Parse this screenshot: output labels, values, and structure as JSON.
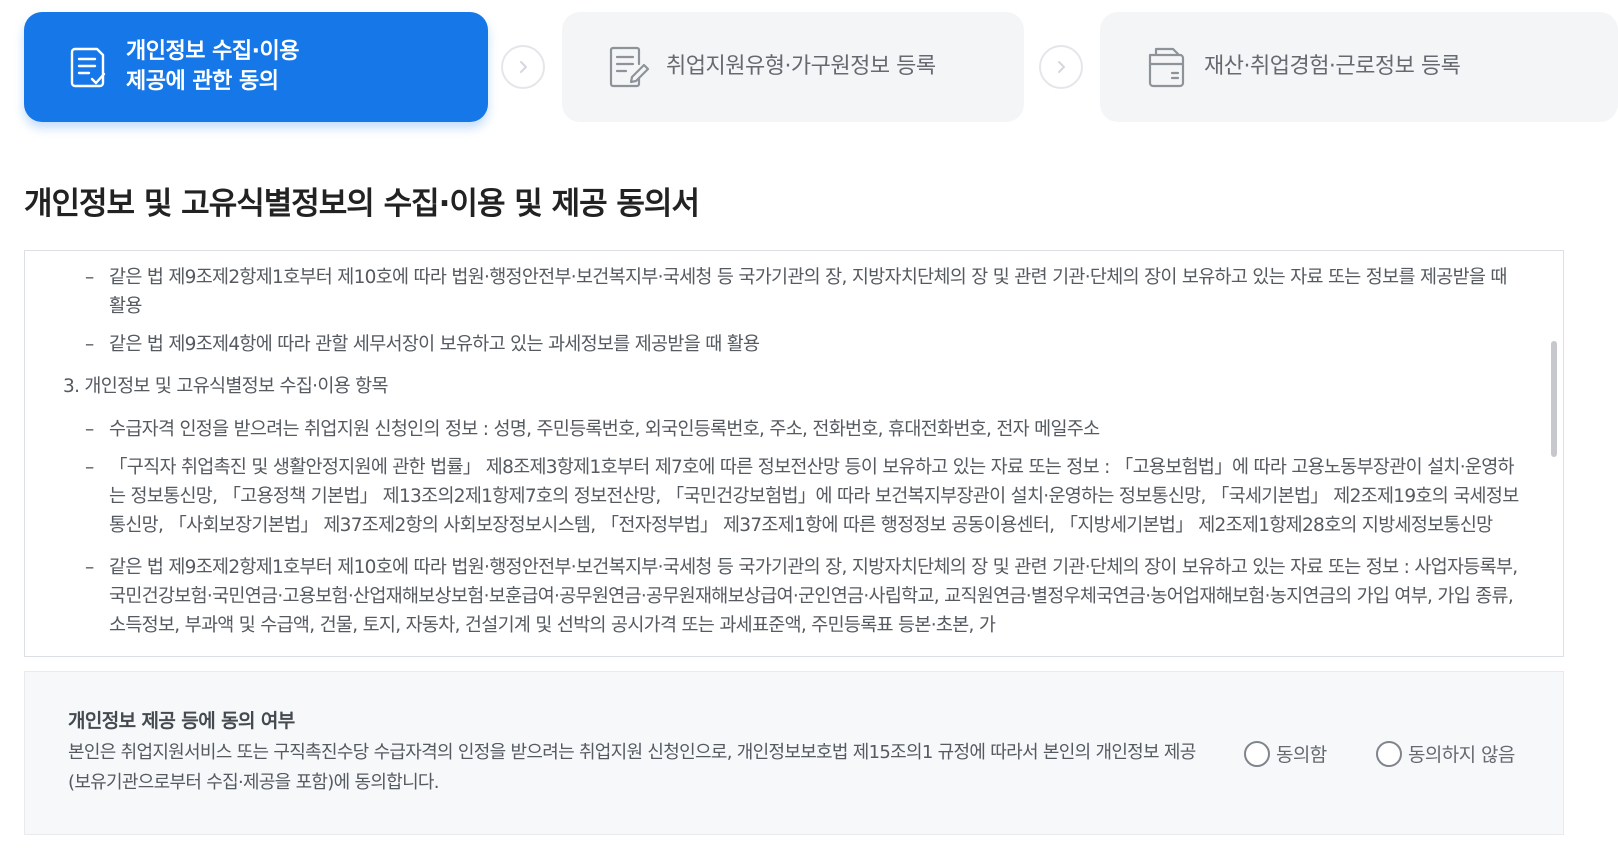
{
  "steps": [
    {
      "label_line1": "개인정보 수집·이용",
      "label_line2": "제공에 관한 동의",
      "icon": "document-check-icon",
      "active": true
    },
    {
      "label": "취업지원유형·가구원정보 등록",
      "icon": "document-edit-icon",
      "active": false
    },
    {
      "label": "재산·취업경험·근로정보 등록",
      "icon": "folder-document-icon",
      "active": false
    }
  ],
  "title": "개인정보 및 고유식별정보의 수집·이용 및 제공 동의서",
  "terms": {
    "items": [
      "같은 법 제9조제2항제1호부터 제10호에 따라 법원·행정안전부·보건복지부·국세청 등 국가기관의 장, 지방자치단체의 장 및 관련 기관·단체의 장이 보유하고 있는 자료 또는 정보를 제공받을 때 활용",
      "같은 법 제9조제4항에 따라 관할 세무서장이 보유하고 있는 과세정보를 제공받을 때 활용",
      "수급자격 인정을 받으려는 취업지원 신청인의 정보 : 성명, 주민등록번호, 외국인등록번호, 주소, 전화번호, 휴대전화번호, 전자 메일주소",
      "「구직자 취업촉진 및 생활안정지원에 관한 법률」 제8조제3항제1호부터 제7호에 따른 정보전산망 등이 보유하고 있는 자료 또는 정보 : 「고용보험법」에 따라 고용노동부장관이 설치·운영하는 정보통신망, 「고용정책 기본법」 제13조의2제1항제7호의 정보전산망, 「국민건강보험법」에 따라 보건복지부장관이 설치·운영하는 정보통신망, 「국세기본법」 제2조제19호의 국세정보통신망, 「사회보장기본법」 제37조제2항의 사회보장정보시스템, 「전자정부법」 제37조제1항에 따른 행정정보 공동이용센터, 「지방세기본법」 제2조제1항제28호의 지방세정보통신망",
      "같은 법 제9조제2항제1호부터 제10호에 따라 법원·행정안전부·보건복지부·국세청 등 국가기관의 장, 지방자치단체의 장 및 관련 기관·단체의 장이 보유하고 있는 자료 또는 정보 : 사업자등록부, 국민건강보험·국민연금·고용보험·산업재해보상보험·보훈급여·공무원연금·공무원재해보상급여·군인연금·사립학교, 교직원연금·별정우체국연금·농어업재해보험·농지연금의 가입 여부, 가입 종류, 소득정보, 부과액 및 수급액, 건물, 토지, 자동차, 건설기계 및 선박의 공시가격 또는 과세표준액, 주민등록표 등본·초본, 가"
    ],
    "dash": "–",
    "section3_heading": "3. 개인정보 및 고유식별정보 수집·이용 항목"
  },
  "consent": {
    "title": "개인정보 제공 등에 동의 여부",
    "text": "본인은 취업지원서비스 또는 구직촉진수당 수급자격의 인정을 받으려는 취업지원 신청인으로, 개인정보보호법 제15조의1 규정에 따라서 본인의 개인정보 제공(보유기관으로부터 수집·제공을 포함)에 동의합니다.",
    "agree_label": "동의함",
    "disagree_label": "동의하지 않음",
    "selected": null
  },
  "colors": {
    "accent": "#1677e8",
    "step_inactive_bg": "#f4f5f7",
    "text": "#555a60"
  }
}
